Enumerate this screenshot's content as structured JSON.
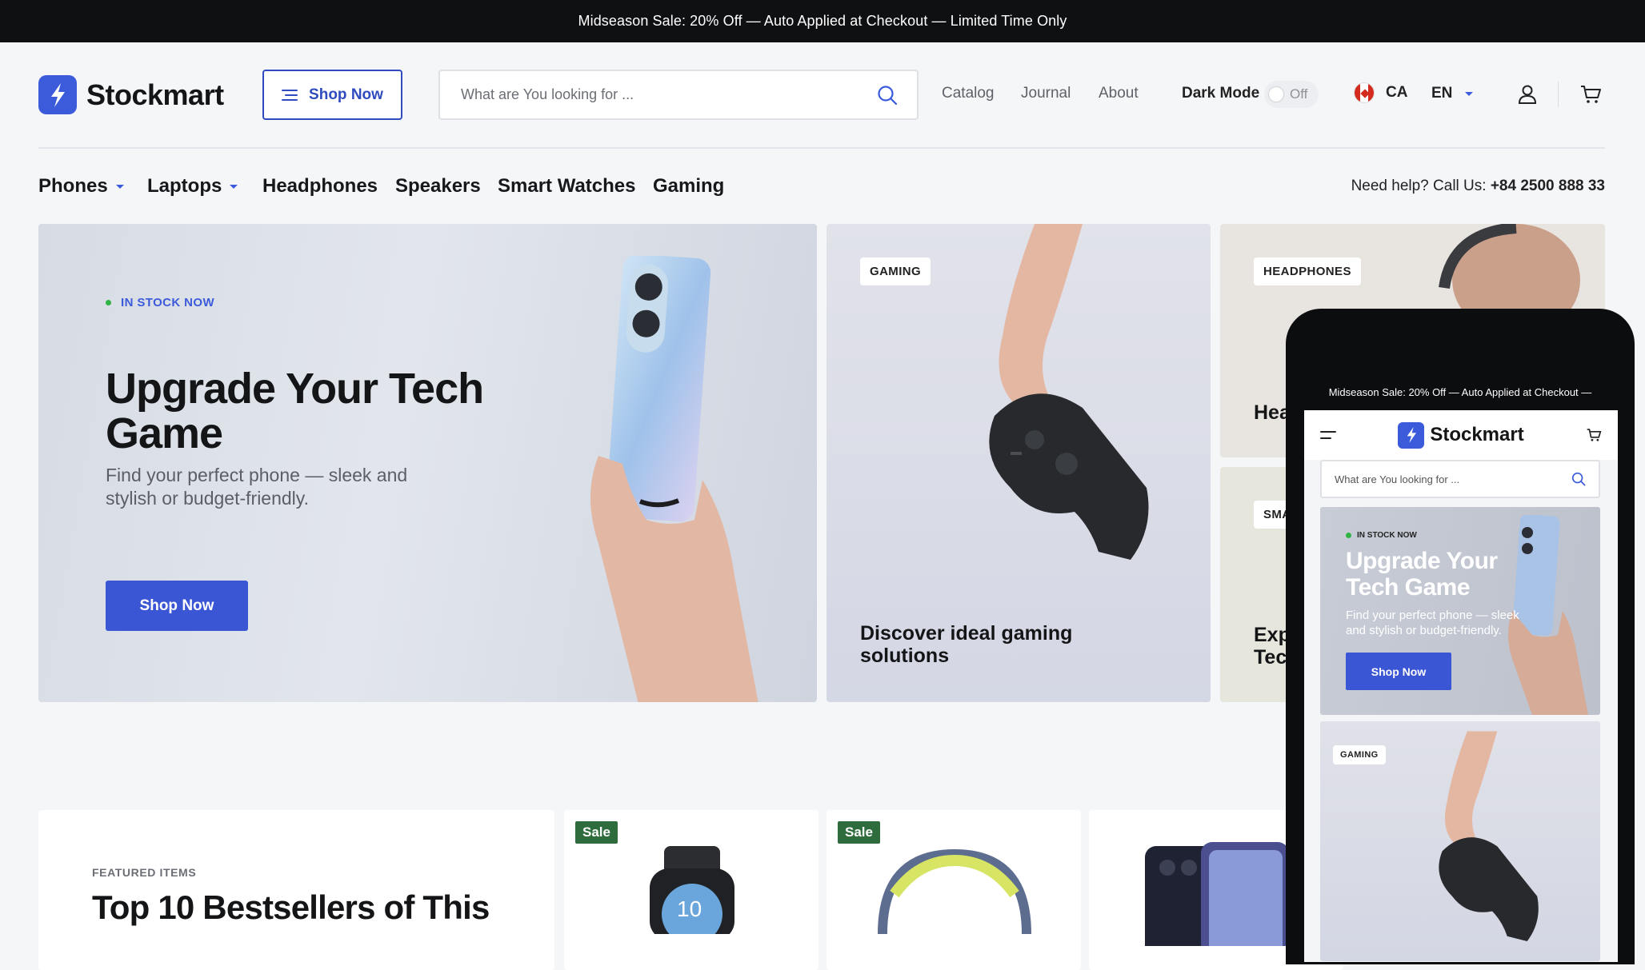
{
  "announcement": "Midseason Sale: 20% Off — Auto Applied at Checkout — Limited Time Only",
  "brand": {
    "name": "Stockmart",
    "accent": "#3b5bdb"
  },
  "header": {
    "shop_now_label": "Shop Now",
    "search_placeholder": "What are You looking for ...",
    "nav": [
      "Catalog",
      "Journal",
      "About"
    ],
    "dark_mode_label": "Dark Mode",
    "dark_mode_state": "Off",
    "country": "CA",
    "language": "EN"
  },
  "categories": [
    {
      "label": "Phones",
      "has_dropdown": true
    },
    {
      "label": "Laptops",
      "has_dropdown": true
    },
    {
      "label": "Headphones",
      "has_dropdown": false
    },
    {
      "label": "Speakers",
      "has_dropdown": false
    },
    {
      "label": "Smart Watches",
      "has_dropdown": false
    },
    {
      "label": "Gaming",
      "has_dropdown": false
    }
  ],
  "help": {
    "text": "Need help? Call Us:",
    "phone": "+84 2500 888 33"
  },
  "hero": {
    "badge": "IN STOCK NOW",
    "title": "Upgrade Your Tech Game",
    "subtitle": "Find your perfect phone — sleek and stylish or budget-friendly.",
    "button": "Shop Now"
  },
  "cards": {
    "gaming": {
      "tag": "GAMING",
      "title": "Discover ideal gaming solutions"
    },
    "headphones": {
      "tag": "HEADPHONES",
      "title": "Hea"
    },
    "smartwatches": {
      "tag": "SMA",
      "title": "Exp Tec"
    }
  },
  "featured": {
    "label": "FEATURED ITEMS",
    "title": "Top 10 Bestsellers of This",
    "sale_badge": "Sale",
    "watch_face_text": "10"
  },
  "mobile": {
    "announcement": "Midseason Sale: 20% Off — Auto Applied at Checkout —",
    "brand": "Stockmart",
    "search_placeholder": "What are You looking for ...",
    "hero_badge": "IN STOCK NOW",
    "hero_title": "Upgrade Your Tech Game",
    "hero_subtitle": "Find your perfect phone — sleek and stylish or budget-friendly.",
    "hero_button": "Shop Now",
    "gaming_tag": "GAMING"
  }
}
